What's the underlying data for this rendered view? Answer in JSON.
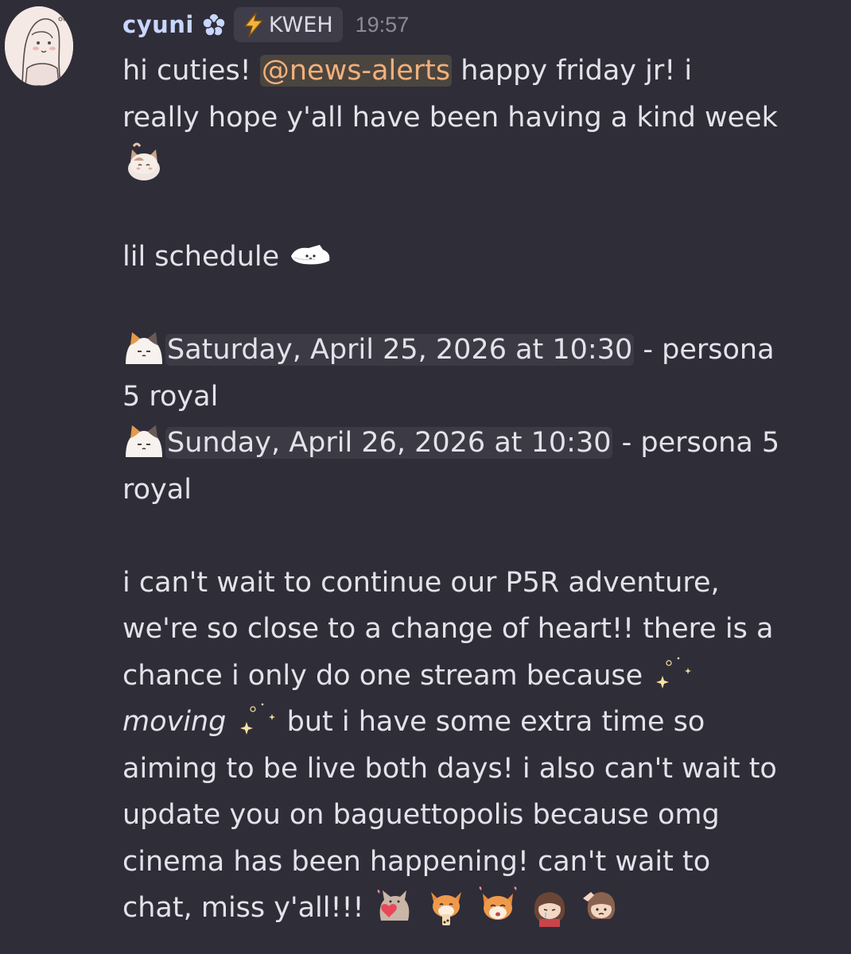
{
  "message": {
    "author": {
      "username": "cyuni",
      "badge_icon": "flower-icon",
      "tag_icon": "lightning-bolt-icon",
      "tag_label": "KWEH"
    },
    "time": "19:57",
    "lines": {
      "l1_a": "hi cuties!",
      "l1_mention": "@news-alerts",
      "l1_b": "happy friday jr! i",
      "l2": "really hope y'all have been having a kind week",
      "l4": "lil schedule",
      "s1_timestamp": "Saturday, April 25, 2026 at 10:30",
      "s1_rest": "- persona",
      "s1_wrap": "5 royal",
      "s2_timestamp": "Sunday, April 26, 2026 at 10:30",
      "s2_rest": "- persona 5",
      "s2_wrap": "royal",
      "p1": "i can't wait to continue our P5R adventure,",
      "p2": "we're so close to a change of heart!! there is a",
      "p3": "chance i only do one stream because",
      "p4_italic": "moving",
      "p4_rest": "but i have some extra time so",
      "p5": "aiming to be live both days! i also can't wait to",
      "p6": "update you on baguettopolis because omg",
      "p7": "cinema has been happening! can't wait to",
      "p8": "chat, miss y'all!!!"
    },
    "emojis": [
      "cat-wave-emoji",
      "sleeping-cat-emoji",
      "calico-cat-emoji",
      "sparkles-emoji",
      "cat-heart-emoji",
      "fox-drink-emoji",
      "fox-happy-emoji",
      "girl-cry-emoji",
      "girl-salute-emoji"
    ],
    "colors": {
      "background": "#2f2d38",
      "username": "#c9d6ff",
      "text": "#e3e2ea",
      "mention_text": "#f2b07a",
      "mention_bg": "#4b4540",
      "timestamp_bg": "#3b3a45",
      "meta": "#8d8b99"
    }
  }
}
